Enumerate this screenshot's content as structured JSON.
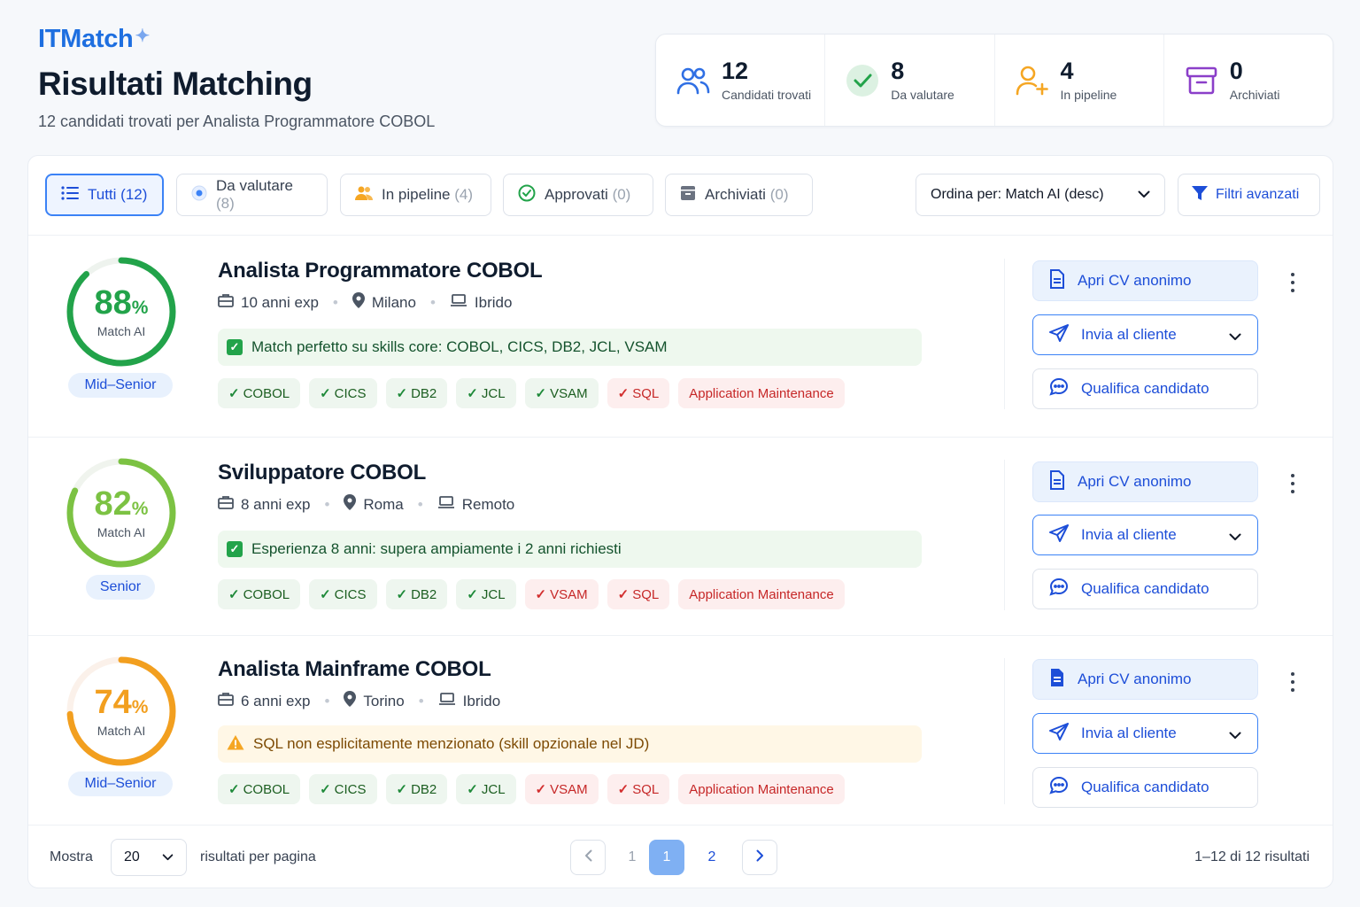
{
  "brand": {
    "name": "ITMatch",
    "spark": "✦"
  },
  "page": {
    "title": "Risultati Matching",
    "subtitle": "12 candidati trovati per Analista Programmatore COBOL"
  },
  "stats": [
    {
      "value": "12",
      "label": "Candidati trovati",
      "icon": "users-icon",
      "color": "#2f6fe4"
    },
    {
      "value": "8",
      "label": "Da valutare",
      "icon": "check-circle-icon",
      "color": "#22a34a"
    },
    {
      "value": "4",
      "label": "In pipeline",
      "icon": "user-plus-icon",
      "color": "#f5a623"
    },
    {
      "value": "0",
      "label": "Archiviati",
      "icon": "archive-icon",
      "color": "#8b3fc9"
    }
  ],
  "filters": {
    "tabs": [
      {
        "label": "Tutti",
        "count": "(12)",
        "icon": "list-icon",
        "active": true
      },
      {
        "label": "Da valutare",
        "count": "(8)",
        "icon": "radio-dot-icon"
      },
      {
        "label": "In pipeline",
        "count": "(4)",
        "icon": "users-icon"
      },
      {
        "label": "Approvati",
        "count": "(0)",
        "icon": "check-circle-icon"
      },
      {
        "label": "Archiviati",
        "count": "(0)",
        "icon": "archive-icon"
      }
    ],
    "sort_label": "Ordina per: Match AI (desc)",
    "advanced_label": "Filtri avanzati"
  },
  "candidates": [
    {
      "score": "88",
      "pct_sign": "%",
      "score_fraction": 0.88,
      "score_label": "Match AI",
      "color": "#22a34a",
      "track": "#eef3ee",
      "level": "Mid–Senior",
      "title": "Analista Programmatore COBOL",
      "exp": "10 anni exp",
      "city": "Milano",
      "mode": "Ibrido",
      "note": {
        "type": "good",
        "text": "Match perfetto su skills core: COBOL, CICS, DB2, JCL, VSAM"
      },
      "tags": [
        {
          "t": "COBOL",
          "s": "ok"
        },
        {
          "t": "CICS",
          "s": "ok"
        },
        {
          "t": "DB2",
          "s": "ok"
        },
        {
          "t": "JCL",
          "s": "ok"
        },
        {
          "t": "VSAM",
          "s": "ok"
        },
        {
          "t": "SQL",
          "s": "ko"
        },
        {
          "t": "Application Maintenance",
          "s": "opt"
        }
      ]
    },
    {
      "score": "82",
      "pct_sign": "%",
      "score_fraction": 0.82,
      "score_label": "Match AI",
      "color": "#7cc243",
      "track": "#f0f4ee",
      "level": "Senior",
      "title": "Sviluppatore COBOL",
      "exp": "8 anni exp",
      "city": "Roma",
      "mode": "Remoto",
      "note": {
        "type": "good",
        "text": "Esperienza 8 anni: supera ampiamente i 2 anni richiesti"
      },
      "tags": [
        {
          "t": "COBOL",
          "s": "ok"
        },
        {
          "t": "CICS",
          "s": "ok"
        },
        {
          "t": "DB2",
          "s": "ok"
        },
        {
          "t": "JCL",
          "s": "ok"
        },
        {
          "t": "VSAM",
          "s": "ko"
        },
        {
          "t": "SQL",
          "s": "ko"
        },
        {
          "t": "Application Maintenance",
          "s": "opt"
        }
      ]
    },
    {
      "score": "74",
      "pct_sign": "%",
      "score_fraction": 0.74,
      "score_label": "Match AI",
      "color": "#f29f1f",
      "track": "#fbf1ea",
      "level": "Mid–Senior",
      "title": "Analista Mainframe COBOL",
      "exp": "6 anni exp",
      "city": "Torino",
      "mode": "Ibrido",
      "note": {
        "type": "warn",
        "text": "SQL non esplicitamente menzionato (skill opzionale nel JD)"
      },
      "tags": [
        {
          "t": "COBOL",
          "s": "ok"
        },
        {
          "t": "CICS",
          "s": "ok"
        },
        {
          "t": "DB2",
          "s": "ok"
        },
        {
          "t": "JCL",
          "s": "ok"
        },
        {
          "t": "VSAM",
          "s": "ko"
        },
        {
          "t": "SQL",
          "s": "ko"
        },
        {
          "t": "Application Maintenance",
          "s": "opt"
        }
      ]
    }
  ],
  "actions": {
    "open_cv": "Apri CV anonimo",
    "send": "Invia al cliente",
    "qualify": "Qualifica candidato"
  },
  "footer": {
    "show": "Mostra",
    "per_page": "20",
    "per_page_suffix": "risultati per pagina",
    "pages": [
      "1",
      "1",
      "2"
    ],
    "current_page": "1",
    "range": "1–12 di 12 risultati"
  }
}
